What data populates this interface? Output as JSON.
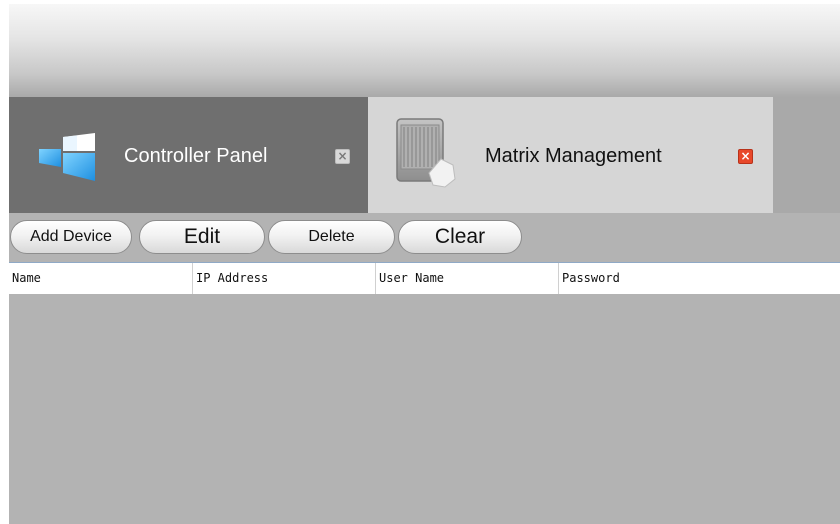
{
  "tabs": [
    {
      "label": "Controller Panel",
      "icon": "windows-logo-icon",
      "close_icon": "close-icon"
    },
    {
      "label": "Matrix Management",
      "icon": "matrix-device-icon",
      "close_icon": "close-icon"
    }
  ],
  "toolbar": {
    "add_device": "Add Device",
    "edit": "Edit",
    "delete": "Delete",
    "clear": "Clear"
  },
  "table": {
    "columns": [
      "Name",
      "IP Address",
      "User Name",
      "Password"
    ],
    "rows": []
  },
  "colors": {
    "active_close": "#e8482a",
    "tab_inactive": "#6f6f6f",
    "tab_active": "#d6d6d6",
    "background": "#b3b3b3"
  }
}
